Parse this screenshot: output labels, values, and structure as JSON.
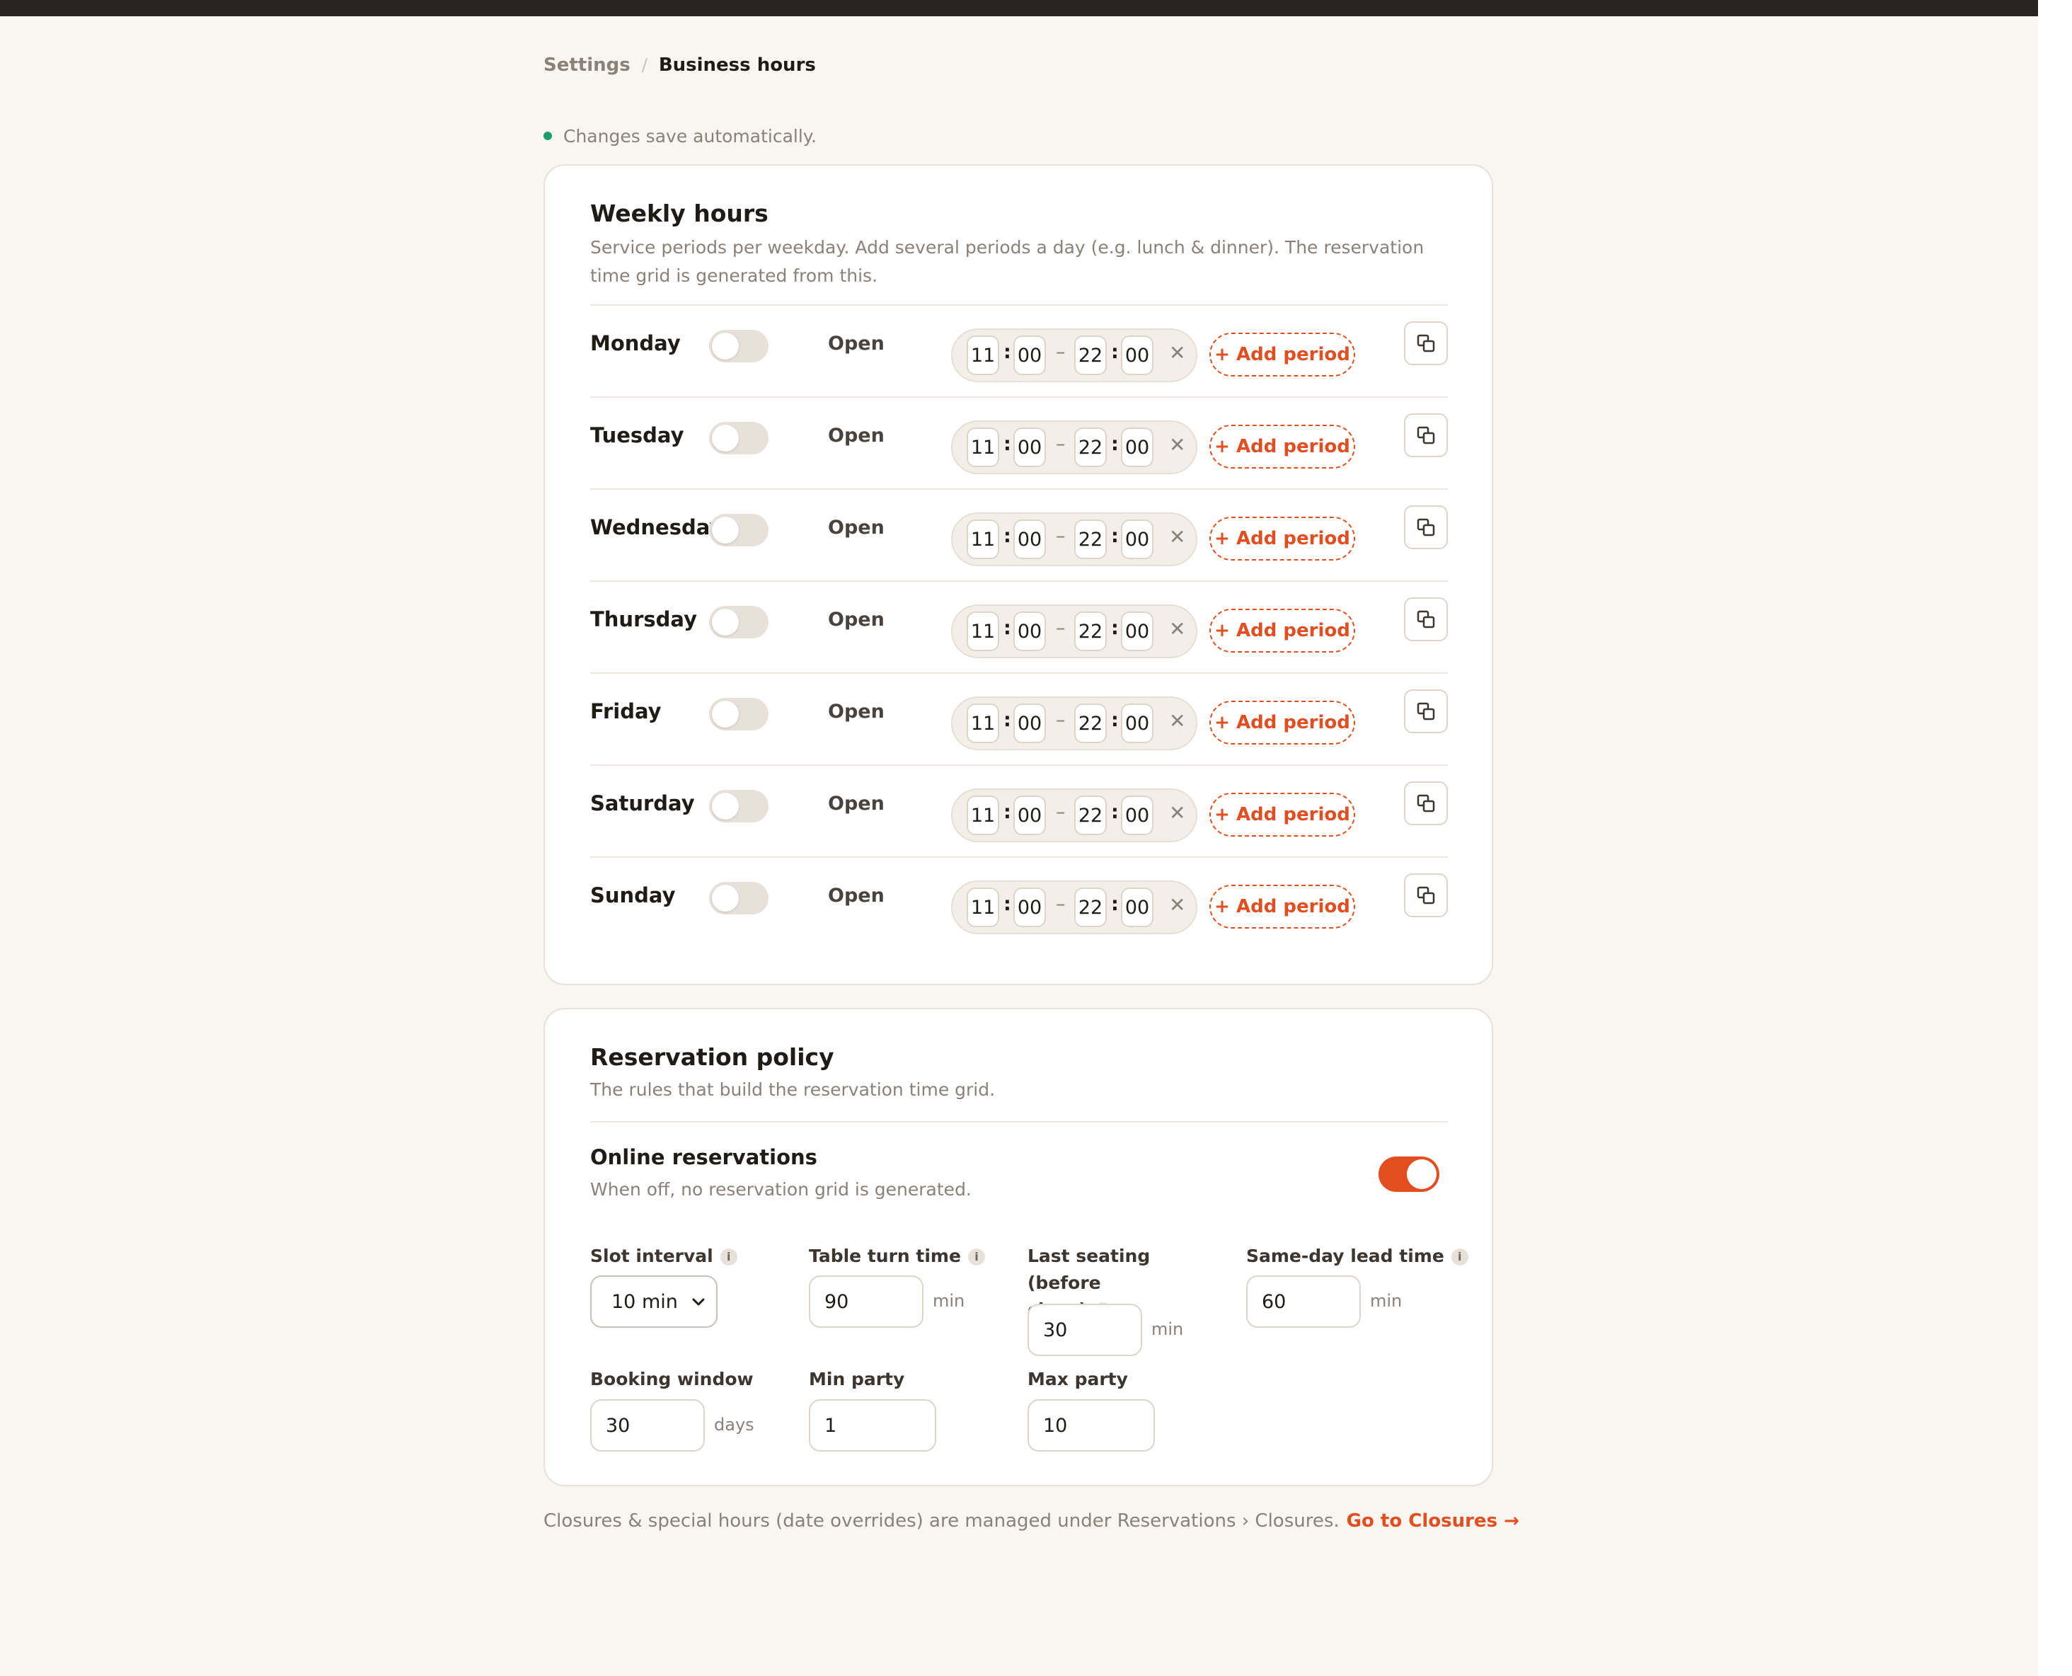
{
  "breadcrumb": {
    "parent": "Settings",
    "separator": "/",
    "current": "Business hours"
  },
  "autosave": {
    "text": "Changes save automatically.",
    "status_color": "#1a9e6b"
  },
  "weekly": {
    "title": "Weekly hours",
    "description": "Service periods per weekday. Add several periods a day (e.g. lunch & dinner). The reservation time grid is generated from this.",
    "open_label": "Open",
    "add_period_label": "+ Add period",
    "days": [
      {
        "name": "Monday",
        "start_h": "11",
        "start_m": "00",
        "end_h": "22",
        "end_m": "00",
        "open": false
      },
      {
        "name": "Tuesday",
        "start_h": "11",
        "start_m": "00",
        "end_h": "22",
        "end_m": "00",
        "open": false
      },
      {
        "name": "Wednesday",
        "start_h": "11",
        "start_m": "00",
        "end_h": "22",
        "end_m": "00",
        "open": false
      },
      {
        "name": "Thursday",
        "start_h": "11",
        "start_m": "00",
        "end_h": "22",
        "end_m": "00",
        "open": false
      },
      {
        "name": "Friday",
        "start_h": "11",
        "start_m": "00",
        "end_h": "22",
        "end_m": "00",
        "open": false
      },
      {
        "name": "Saturday",
        "start_h": "11",
        "start_m": "00",
        "end_h": "22",
        "end_m": "00",
        "open": false
      },
      {
        "name": "Sunday",
        "start_h": "11",
        "start_m": "00",
        "end_h": "22",
        "end_m": "00",
        "open": false
      }
    ],
    "icons": {
      "remove": "close-icon",
      "copy": "copy-icon"
    }
  },
  "policy": {
    "title": "Reservation policy",
    "description": "The rules that build the reservation time grid.",
    "online": {
      "title": "Online reservations",
      "description": "When off, no reservation grid is generated.",
      "enabled": true
    },
    "slot_interval": {
      "label": "Slot interval",
      "value": "10 min"
    },
    "table_turn": {
      "label": "Table turn time",
      "value": "90",
      "unit": "min"
    },
    "last_seating": {
      "label_line1": "Last seating (before",
      "label_line2": "close)",
      "value": "30",
      "unit": "min"
    },
    "lead_time": {
      "label": "Same-day lead time",
      "value": "60",
      "unit": "min"
    },
    "booking_window": {
      "label": "Booking window",
      "value": "30",
      "unit": "days"
    },
    "min_party": {
      "label": "Min party",
      "value": "1"
    },
    "max_party": {
      "label": "Max party",
      "value": "10"
    },
    "info_glyph": "i"
  },
  "footer": {
    "text": "Closures & special hours (date overrides) are managed under Reservations › Closures.",
    "link": "Go to Closures →"
  },
  "colors": {
    "accent": "#e24e20",
    "background": "#f9f6f1",
    "card": "#ffffff",
    "muted": "#8a8179",
    "topbar": "#292421"
  }
}
